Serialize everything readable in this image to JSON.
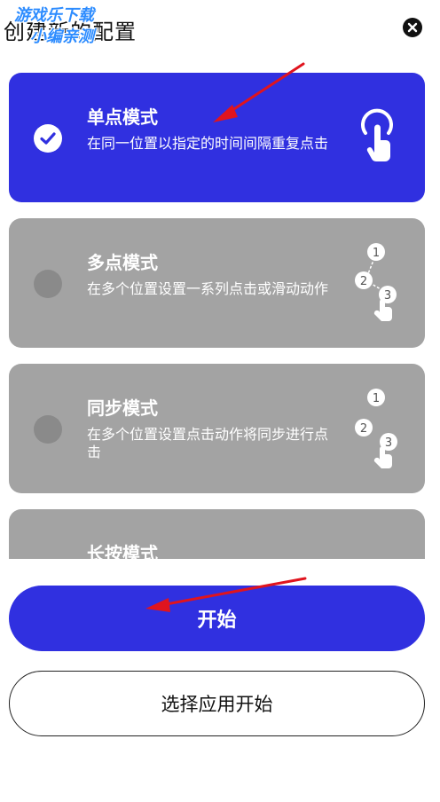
{
  "header": {
    "title": "创建新的配置",
    "watermark_line1": "游戏乐下载",
    "watermark_line2": "小编亲测",
    "close_icon": "close-icon"
  },
  "modes": [
    {
      "title": "单点模式",
      "desc": "在同一位置以指定的时间间隔重复点击",
      "selected": true,
      "icon": "tap-icon"
    },
    {
      "title": "多点模式",
      "desc": "在多个位置设置一系列点击或滑动动作",
      "selected": false,
      "icon": "multi-tap-icon"
    },
    {
      "title": "同步模式",
      "desc": "在多个位置设置点击动作将同步进行点击",
      "selected": false,
      "icon": "sync-tap-icon"
    },
    {
      "title": "长按模式",
      "desc": "",
      "selected": false,
      "icon": "long-press-icon"
    }
  ],
  "actions": {
    "start_label": "开始",
    "choose_app_label": "选择应用开始"
  },
  "colors": {
    "accent": "#3030e0",
    "card_inactive": "#a3a3a3",
    "annotation_arrow": "#e0141e"
  }
}
